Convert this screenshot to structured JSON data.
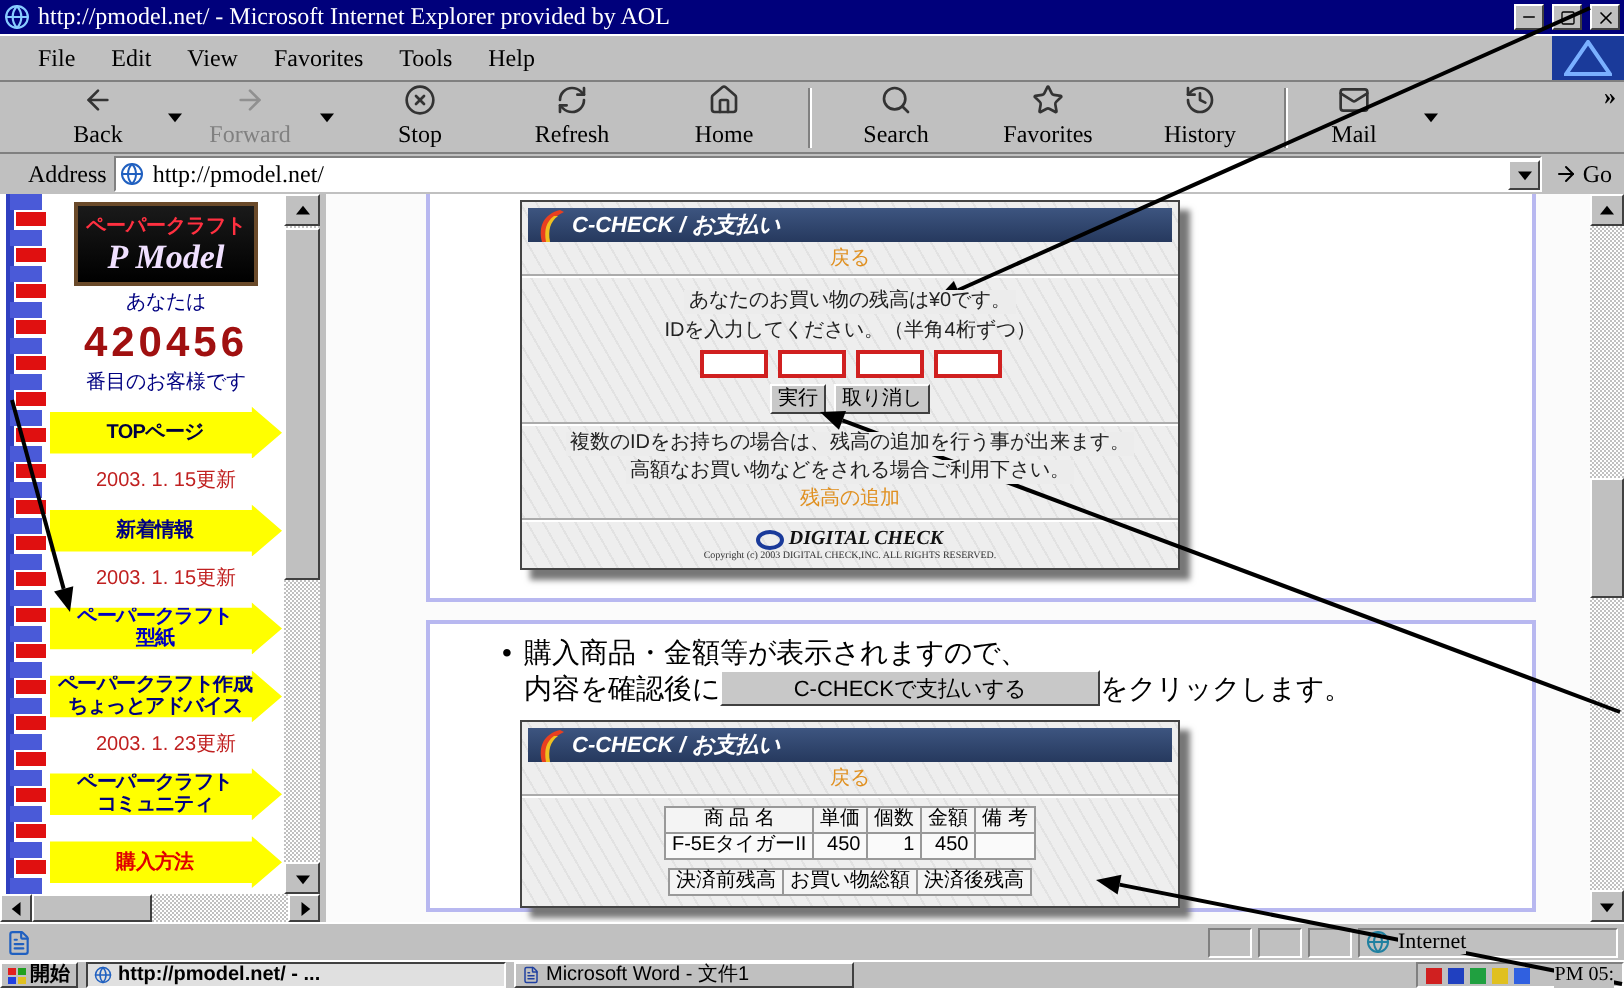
{
  "window": {
    "title": "http://pmodel.net/ - Microsoft Internet Explorer provided by AOL"
  },
  "menu": [
    "File",
    "Edit",
    "View",
    "Favorites",
    "Tools",
    "Help"
  ],
  "toolbar": [
    {
      "kind": "back",
      "label": "Back",
      "disabled": false,
      "dropdown": true,
      "separator_before": false
    },
    {
      "kind": "forward",
      "label": "Forward",
      "disabled": true,
      "dropdown": true,
      "separator_before": false
    },
    {
      "kind": "stop",
      "label": "Stop",
      "disabled": false,
      "dropdown": false,
      "separator_before": false
    },
    {
      "kind": "refresh",
      "label": "Refresh",
      "disabled": false,
      "dropdown": false,
      "separator_before": false
    },
    {
      "kind": "home",
      "label": "Home",
      "disabled": false,
      "dropdown": false,
      "separator_before": false
    },
    {
      "kind": "search",
      "label": "Search",
      "disabled": false,
      "dropdown": false,
      "separator_before": true
    },
    {
      "kind": "favorites",
      "label": "Favorites",
      "disabled": false,
      "dropdown": false,
      "separator_before": false
    },
    {
      "kind": "history",
      "label": "History",
      "disabled": false,
      "dropdown": false,
      "separator_before": false
    },
    {
      "kind": "mail",
      "label": "Mail",
      "disabled": false,
      "dropdown": true,
      "separator_before": true
    }
  ],
  "toolbar_more": "»",
  "address": {
    "label": "Address",
    "value": "http://pmodel.net/",
    "go": "Go"
  },
  "sidebar": {
    "logo_top": "ペーパークラフト",
    "logo_main": "P Model",
    "counter_before": "あなたは",
    "counter": "420456",
    "counter_after": "番目のお客様です",
    "items": [
      {
        "lines": [
          "TOPページ"
        ],
        "color": "#000040"
      },
      {
        "update": "2003. 1. 15更新",
        "lines": [
          "新着情報"
        ],
        "color": "#000080"
      },
      {
        "update": "2003. 1. 15更新",
        "lines": [
          "ペーパークラフト",
          "型紙"
        ],
        "color": "#0000c0"
      },
      {
        "lines": [
          "ペーパークラフト作成",
          "ちょっとアドバイス"
        ],
        "color": "#000080"
      },
      {
        "update": "2003. 1. 23更新",
        "lines": [
          "ペーパークラフト",
          "コミュニティ"
        ],
        "color": "#000080"
      },
      {
        "lines": [
          "購入方法"
        ],
        "color": "#e00000"
      }
    ]
  },
  "payment_form": {
    "title": "C-CHECK / お支払い",
    "back_link": "戻る",
    "message": "あなたのお買い物の残高は¥0です。",
    "id_prompt": "IDを入力してください。（半角4桁ずつ）",
    "id_fields": [
      {
        "highlighted": true
      },
      {
        "highlighted": true
      },
      {
        "highlighted": true
      },
      {
        "highlighted": true
      }
    ],
    "buttons": [
      "実行",
      "取り消し"
    ],
    "note_lines": [
      "複数のIDをお持ちの場合は、残高の追加を行う事が出来ます。",
      "高額なお買い物などをされる場合ご利用下さい。"
    ],
    "add_link": "残高の追加",
    "brand": "DIGITAL CHECK",
    "copyright": "Copyright (c) 2003 DIGITAL CHECK,INC. ALL RIGHTS RESERVED."
  },
  "step": {
    "bullet": "•",
    "line": "購入商品・金額等が表示されますので、",
    "before": "内容を確認後に",
    "button": "C-CHECKで支払いする",
    "after": "をクリックします。"
  },
  "confirm_form": {
    "title": "C-CHECK / お支払い",
    "back_link": "戻る",
    "columns": [
      "商 品 名",
      "単価",
      "個数",
      "金額",
      "備 考"
    ],
    "rows": [
      [
        "F-5EタイガーII",
        "450",
        "1",
        "450"
      ]
    ],
    "balance_columns": [
      "決済前残高",
      "お買い物総額",
      "決済後残高"
    ]
  },
  "status_bar": {
    "zone": "Internet"
  },
  "taskbar": {
    "start": "開始",
    "tasks": [
      {
        "label": "http://pmodel.net/ - ...",
        "selected": true
      },
      {
        "label": "Microsoft Word - 文件1",
        "selected": false
      }
    ],
    "clock": "PM 05:"
  }
}
